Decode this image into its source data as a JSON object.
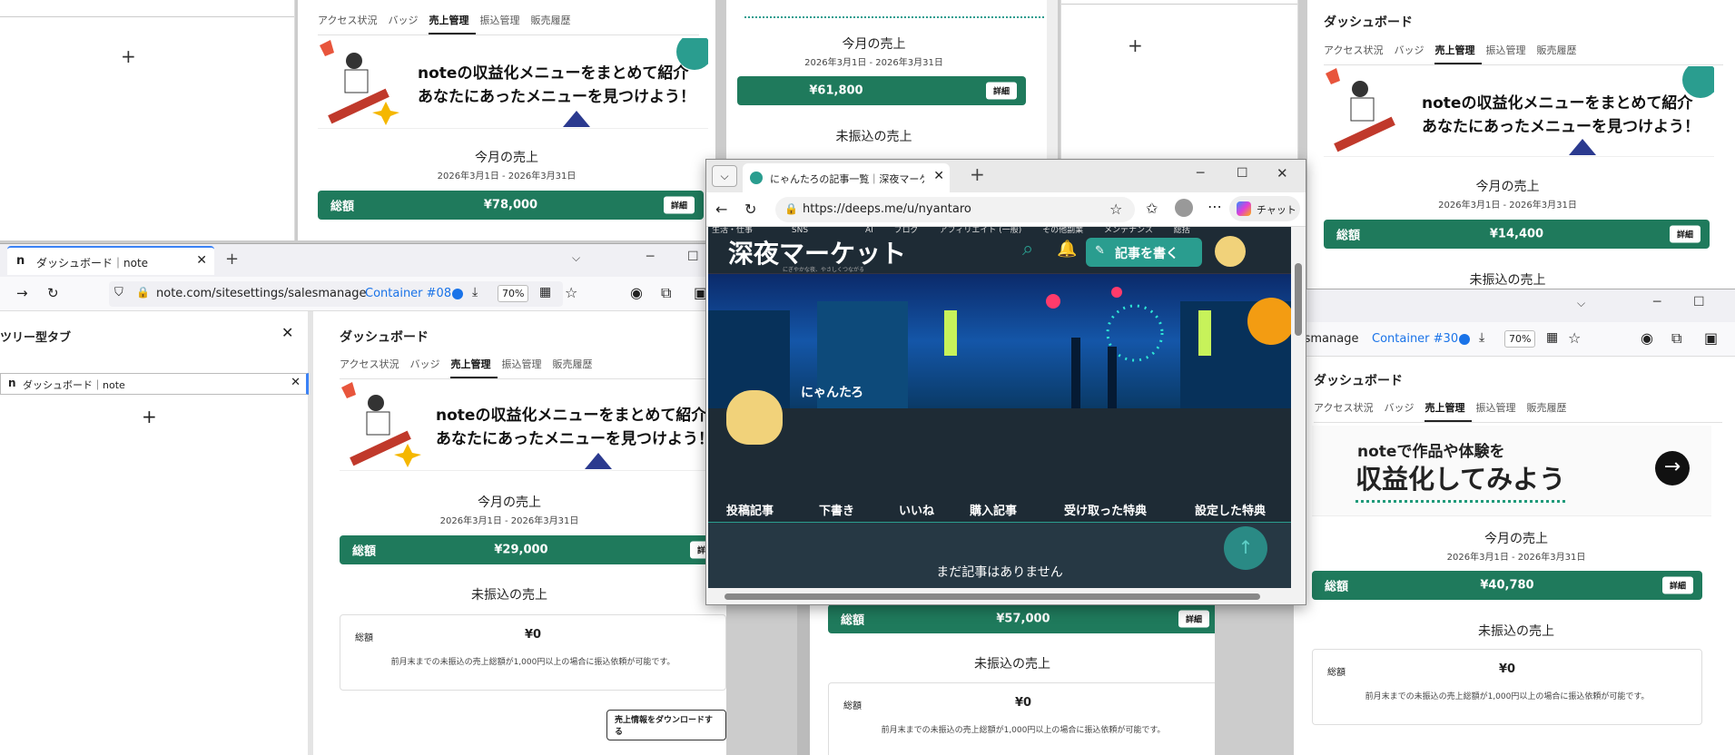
{
  "common": {
    "dashboard_title": "ダッシュボード",
    "tabs": [
      "アクセス状況",
      "バッジ",
      "売上管理",
      "振込管理",
      "販売履歴"
    ],
    "banner_line1": "noteの収益化メニューをまとめて紹介",
    "banner_line2": "あなたにあったメニューを見つけよう！",
    "banner2_line1": "noteで作品や体験を",
    "banner2_line2": "収益化してみよう",
    "this_month": "今月の売上",
    "date_range": "2026年3月1日 - 2026年3月31日",
    "total_label": "総額",
    "detail_button": "詳細",
    "unpaid_title": "未振込の売上",
    "unpaid_total": "¥0",
    "unpaid_note": "前月末までの未振込の売上総額が1,000円以上の場合に振込依頼が可能です。",
    "download_button": "売上情報をダウンロードする"
  },
  "top_left_panel": {
    "plus": "+"
  },
  "win_a": {
    "total": "¥78,000"
  },
  "win_b": {
    "total": "¥61,800"
  },
  "win_c": {
    "total": "¥14,400",
    "plus": "+"
  },
  "win_d": {
    "tab_title": "ダッシュボード｜note",
    "url": "note.com/sitesettings/salesmanage",
    "container": "Container #08",
    "zoom": "70%",
    "sidebar_title": "ツリー型タブ",
    "sidebar_tab": "ダッシュボード｜note",
    "total": "¥29,000"
  },
  "win_e": {
    "total": "¥57,000"
  },
  "win_f": {
    "url_suffix": "lesmanage",
    "container": "Container #30",
    "zoom": "70%",
    "total": "¥40,780"
  },
  "edge": {
    "tab_title": "にゃんたろの記事一覧｜深夜マーケット",
    "url": "https://deeps.me/u/nyantaro",
    "chat_label": "チャット",
    "site_logo": "深夜マーケット",
    "site_tagline": "にぎやかな夜、やさしくつながる",
    "nav_items": [
      "生活・仕事",
      "SNS",
      "AI",
      "ブログ",
      "アフィリエイト\n(一般)",
      "その他副業",
      "メンテナンス",
      "総括"
    ],
    "write_button": "記事を書く",
    "user_name": "にゃんたろ",
    "profile_tabs": [
      "投稿記事",
      "下書き",
      "いいね",
      "購入記事",
      "受け取った特典",
      "設定した特典"
    ],
    "empty_message": "まだ記事はありません"
  },
  "colors": {
    "green": "#1f7a5c",
    "dark": "#1e2b35",
    "teal": "#2a9d8f",
    "container_blue": "#1a73e8"
  }
}
